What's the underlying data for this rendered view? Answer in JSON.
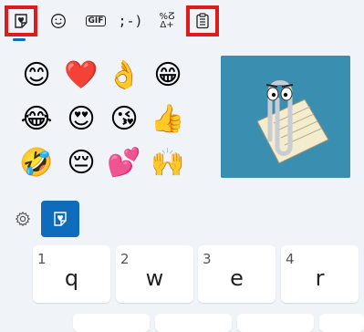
{
  "tabs": [
    {
      "id": "kaomoji-heart",
      "icon": "heart-sticker-icon",
      "highlighted": true
    },
    {
      "id": "emoji",
      "icon": "smiley-icon"
    },
    {
      "id": "gif",
      "label": "GIF"
    },
    {
      "id": "kaomoji",
      "label": ";-)"
    },
    {
      "id": "symbols",
      "label": "%̈ Δ+"
    },
    {
      "id": "clipboard",
      "icon": "clipboard-icon",
      "highlighted": true
    }
  ],
  "emojis": [
    "😊",
    "❤️",
    "👌",
    "😁",
    "😂",
    "😍",
    "😘",
    "👍",
    "🤣",
    "😔",
    "💕",
    "🙌"
  ],
  "gif": {
    "description": "Clippy paperclip on note"
  },
  "keys": [
    {
      "num": "1",
      "char": "q"
    },
    {
      "num": "2",
      "char": "w"
    },
    {
      "num": "3",
      "char": "e"
    },
    {
      "num": "4",
      "char": "r"
    }
  ],
  "colors": {
    "accent": "#0f6cbd",
    "highlight": "#e01b1b",
    "background": "#f0f4f9"
  }
}
